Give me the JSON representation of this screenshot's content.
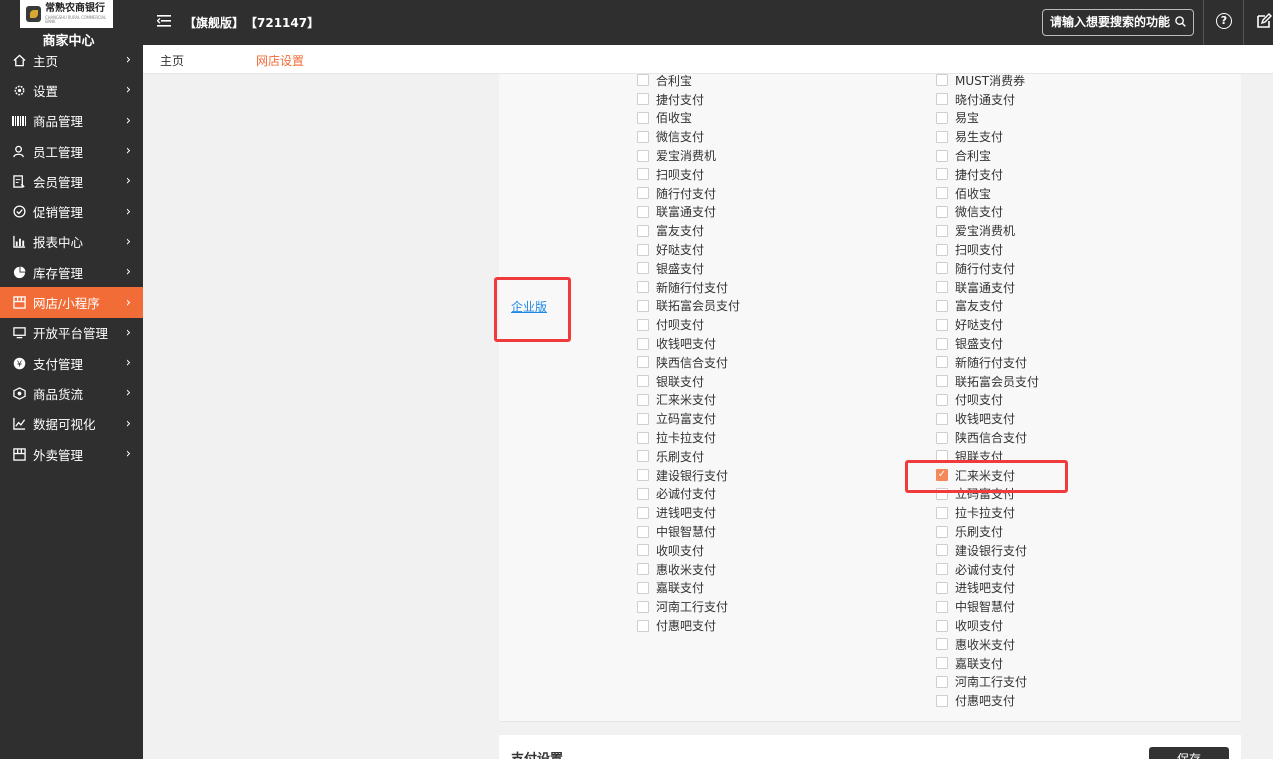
{
  "sidebar": {
    "logo_text": "常熟农商银行",
    "logo_subtext": "CHANGSHU RURAL COMMERCIAL BANK",
    "brand": "商家中心",
    "items": [
      {
        "label": "主页",
        "icon": "home-icon"
      },
      {
        "label": "设置",
        "icon": "gear-icon"
      },
      {
        "label": "商品管理",
        "icon": "barcode-icon"
      },
      {
        "label": "员工管理",
        "icon": "user-icon"
      },
      {
        "label": "会员管理",
        "icon": "member-card-icon"
      },
      {
        "label": "促销管理",
        "icon": "check-circle-icon"
      },
      {
        "label": "报表中心",
        "icon": "bar-chart-icon"
      },
      {
        "label": "库存管理",
        "icon": "pie-chart-icon"
      },
      {
        "label": "网店/小程序",
        "icon": "store-icon",
        "active": true
      },
      {
        "label": "开放平台管理",
        "icon": "monitor-icon"
      },
      {
        "label": "支付管理",
        "icon": "coin-icon"
      },
      {
        "label": "商品货流",
        "icon": "cube-icon"
      },
      {
        "label": "数据可视化",
        "icon": "line-chart-icon"
      },
      {
        "label": "外卖管理",
        "icon": "store-icon"
      }
    ]
  },
  "topbar": {
    "version": "【旗舰版】",
    "store_id": "【721147】",
    "search_placeholder": "请输入想要搜索的功能"
  },
  "tabs": {
    "home": "主页",
    "current": "网店设置"
  },
  "edition_link": "企业版",
  "col1": [
    "合利宝",
    "捷付支付",
    "佰收宝",
    "微信支付",
    "爱宝消费机",
    "扫呗支付",
    "随行付支付",
    "联富通支付",
    "富友支付",
    "好哒支付",
    "银盛支付",
    "新随行付支付",
    "联拓富会员支付",
    "付呗支付",
    "收钱吧支付",
    "陕西信合支付",
    "银联支付",
    "汇来米支付",
    "立码富支付",
    "拉卡拉支付",
    "乐刷支付",
    "建设银行支付",
    "必诚付支付",
    "进钱吧支付",
    "中银智慧付",
    "收呗支付",
    "惠收米支付",
    "嘉联支付",
    "河南工行支付",
    "付惠吧支付"
  ],
  "col2": [
    "MUST消费券",
    "晓付通支付",
    "易宝",
    "易生支付",
    "合利宝",
    "捷付支付",
    "佰收宝",
    "微信支付",
    "爱宝消费机",
    "扫呗支付",
    "随行付支付",
    "联富通支付",
    "富友支付",
    "好哒支付",
    "银盛支付",
    "新随行付支付",
    "联拓富会员支付",
    "付呗支付",
    "收钱吧支付",
    "陕西信合支付",
    "银联支付",
    "汇来米支付",
    "立码富支付",
    "拉卡拉支付",
    "乐刷支付",
    "建设银行支付",
    "必诚付支付",
    "进钱吧支付",
    "中银智慧付",
    "收呗支付",
    "惠收米支付",
    "嘉联支付",
    "河南工行支付",
    "付惠吧支付"
  ],
  "col2_checked": "汇来米支付",
  "section2": {
    "title": "支付设置",
    "button": "保存"
  },
  "colors": {
    "sidebar_bg": "#2f2f2f",
    "accent": "#f26c38",
    "highlight_border": "#ef3b3b",
    "link": "#1e88e5"
  }
}
